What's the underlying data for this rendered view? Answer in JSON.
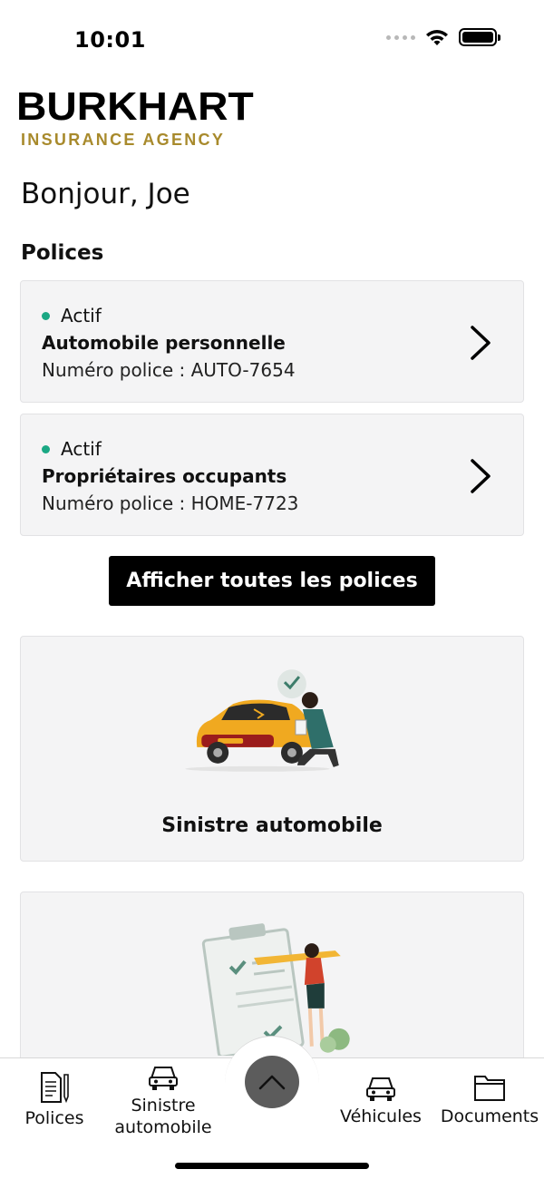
{
  "status_bar": {
    "time": "10:01"
  },
  "logo": {
    "main": "BURKHART",
    "sub": "INSURANCE AGENCY"
  },
  "greeting": "Bonjour, Joe",
  "policies_section": {
    "title": "Polices",
    "items": [
      {
        "status": "Actif",
        "name": "Automobile personnelle",
        "number": "Numéro police : AUTO-7654"
      },
      {
        "status": "Actif",
        "name": "Propriétaires occupants",
        "number": "Numéro police : HOME-7723"
      }
    ],
    "show_all_label": "Afficher toutes les polices"
  },
  "feature_cards": [
    {
      "label": "Sinistre automobile",
      "illustration": "car-claim-illustration"
    },
    {
      "label": "",
      "illustration": "checklist-illustration"
    }
  ],
  "tab_bar": {
    "items": [
      {
        "label": "Polices",
        "icon": "policy-document-icon"
      },
      {
        "label": "Sinistre automobile",
        "icon": "car-icon"
      },
      {
        "label": "Véhicules",
        "icon": "car-icon"
      },
      {
        "label": "Documents",
        "icon": "folder-icon"
      }
    ],
    "center_icon": "chevron-up-icon"
  },
  "colors": {
    "accent_gold": "#a88a2c",
    "status_active": "#1aa884",
    "card_bg": "#f4f4f5"
  }
}
